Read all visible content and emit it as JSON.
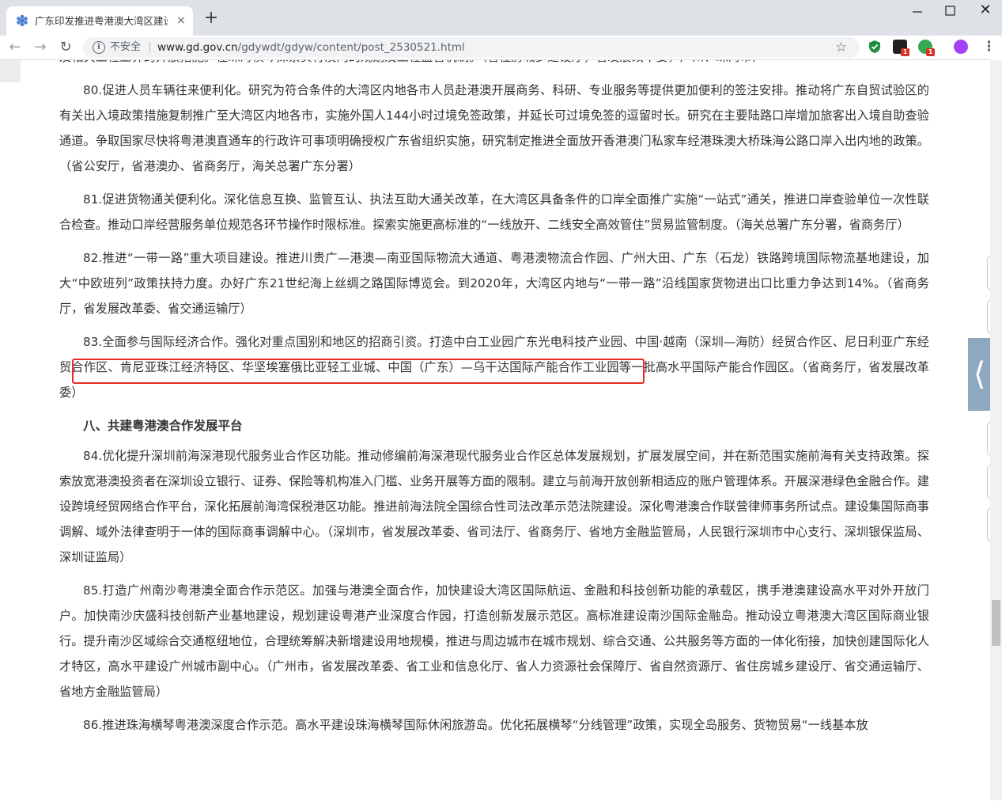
{
  "tab": {
    "title": "广东印发推进粤港澳大湾区建设三",
    "close": "×"
  },
  "window": {
    "close": "✕"
  },
  "toolbar": {
    "insecure_label": "不安全",
    "url_host": "www.gd.gov.cn",
    "url_path": "/gdywdt/gdyw/content/post_2530521.html",
    "badge_count": "1"
  },
  "content": {
    "p_partial": "及相关工程业界的开放措施。在珠海横琴探索实行澳门的规划及工程监管机制。（省住房城乡建设厅，省发展改革委，广州、珠海市）",
    "p80": "80.促进人员车辆往来便利化。研究为符合条件的大湾区内地各市人员赴港澳开展商务、科研、专业服务等提供更加便利的签注安排。推动将广东自贸试验区的有关出入境政策措施复制推广至大湾区内地各市，实施外国人144小时过境免签政策，并延长可过境免签的逗留时长。研究在主要陆路口岸增加旅客出入境自助查验通道。争取国家尽快将粤港澳直通车的行政许可事项明确授权广东省组织实施，研究制定推进全面放开香港澳门私家车经港珠澳大桥珠海公路口岸入出内地的政策。（省公安厅，省港澳办、省商务厅，海关总署广东分署）",
    "p81": "81.促进货物通关便利化。深化信息互换、监管互认、执法互助大通关改革，在大湾区具备条件的口岸全面推广实施“一站式”通关，推进口岸查验单位一次性联合检查。推动口岸经营服务单位规范各环节操作时限标准。探索实施更高标准的“一线放开、二线安全高效管住”贸易监管制度。（海关总署广东分署，省商务厅）",
    "p82": "82.推进“一带一路”重大项目建设。推进川贵广—港澳—南亚国际物流大通道、粤港澳物流合作园、广州大田、广东（石龙）铁路跨境国际物流基地建设，加大“中欧班列”政策扶持力度。办好广东21世纪海上丝绸之路国际博览会。到2020年，大湾区内地与“一带一路”沿线国家货物进出口比重力争达到14%。（省商务厅，省发展改革委、省交通运输厅）",
    "p83": "83.全面参与国际经济合作。强化对重点国别和地区的招商引资。打造中白工业园广东光电科技产业园、中国·越南（深圳—海防）经贸合作区、尼日利亚广东经贸合作区、肯尼亚珠江经济特区、华坚埃塞俄比亚轻工业城、中国（广东）—乌干达国际产能合作工业园等一批高水平国际产能合作园区。（省商务厅，省发展改革委）",
    "heading8": "八、共建粤港澳合作发展平台",
    "p84": "84.优化提升深圳前海深港现代服务业合作区功能。推动修编前海深港现代服务业合作区总体发展规划，扩展发展空间，并在新范围实施前海有关支持政策。探索放宽港澳投资者在深圳设立银行、证券、保险等机构准入门槛、业务开展等方面的限制。建立与前海开放创新相适应的账户管理体系。开展深港绿色金融合作。建设跨境经贸网络合作平台，深化拓展前海湾保税港区功能。推进前海法院全国综合性司法改革示范法院建设。深化粤港澳合作联营律师事务所试点。建设集国际商事调解、域外法律查明于一体的国际商事调解中心。（深圳市，省发展改革委、省司法厅、省商务厅、省地方金融监管局，人民银行深圳市中心支行、深圳银保监局、深圳证监局）",
    "p85": "85.打造广州南沙粤港澳全面合作示范区。加强与港澳全面合作，加快建设大湾区国际航运、金融和科技创新功能的承载区，携手港澳建设高水平对外开放门户。加快南沙庆盛科技创新产业基地建设，规划建设粤港产业深度合作园，打造创新发展示范区。高标准建设南沙国际金融岛。推动设立粤港澳大湾区国际商业银行。提升南沙区域综合交通枢纽地位，合理统筹解决新增建设用地规模，推进与周边城市在城市规划、综合交通、公共服务等方面的一体化衔接，加快创建国际化人才特区，高水平建设广州城市副中心。（广州市，省发展改革委、省工业和信息化厅、省人力资源社会保障厅、省自然资源厅、省住房城乡建设厅、省交通运输厅、省地方金融监管局）",
    "p86": "86.推进珠海横琴粤港澳深度合作示范。高水平建设珠海横琴国际休闲旅游岛。优化拓展横琴“分线管理”政策，实现全岛服务、货物贸易“一线基本放"
  },
  "colors": {
    "highlight_box": "#e62c25",
    "side_arrow": "#8ea9bf"
  }
}
